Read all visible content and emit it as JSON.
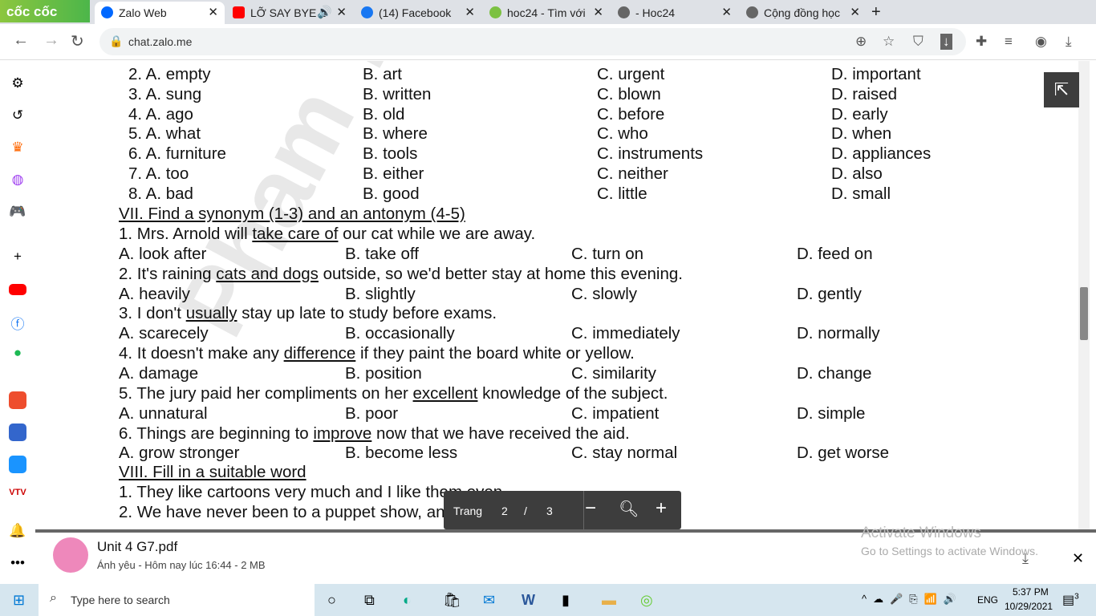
{
  "browser": {
    "brand": "cốc cốc",
    "url": "chat.zalo.me",
    "tabs": [
      {
        "label": "Zalo Web",
        "active": true
      },
      {
        "label": "LỠ SAY BYE L",
        "audio": true
      },
      {
        "label": "(14) Facebook"
      },
      {
        "label": "hoc24 - Tìm với"
      },
      {
        "label": "- Hoc24"
      },
      {
        "label": "Cộng đồng học"
      }
    ]
  },
  "doc": {
    "watermark": "Pham Thu English",
    "mc_rows": [
      [
        "2. A. empty",
        "B. art",
        "C. urgent",
        "D. important"
      ],
      [
        "3. A. sung",
        "B. written",
        "C. blown",
        "D. raised"
      ],
      [
        "4. A. ago",
        "B. old",
        "C. before",
        "D. early"
      ],
      [
        "5. A. what",
        "B. where",
        "C. who",
        "D. when"
      ],
      [
        "6. A. furniture",
        "B. tools",
        "C. instruments",
        "D. appliances"
      ],
      [
        "7. A. too",
        "B. either",
        "C. neither",
        "D. also"
      ],
      [
        "8. A. bad",
        "B. good",
        "C. little",
        "D. small"
      ]
    ],
    "section7": "VII. Find a synonym (1-3) and an antonym (4-5)",
    "questions": [
      {
        "pre": "1. Mrs. Arnold will ",
        "u": "take care of",
        "post": " our cat while we are away.",
        "opts": [
          "A. look after",
          "B. take off",
          "C. turn on",
          "D. feed on"
        ]
      },
      {
        "pre": "2. It's raining ",
        "u": "cats and dogs",
        "post": " outside, so we'd better stay at home this evening.",
        "opts": [
          "A. heavily",
          "B. slightly",
          "C. slowly",
          "D. gently"
        ]
      },
      {
        "pre": "3. I don't ",
        "u": "usually",
        "post": " stay up late to study before exams.",
        "opts": [
          "A. scarecely",
          "B. occasionally",
          "C. immediately",
          "D. normally"
        ]
      },
      {
        "pre": "4. It doesn't make any ",
        "u": "difference",
        "post": " if they paint the board white or yellow.",
        "opts": [
          "A. damage",
          "B. position",
          "C. similarity",
          "D. change"
        ]
      },
      {
        "pre": "5. The jury paid her compliments on her ",
        "u": "excellent",
        "post": " knowledge of the subject.",
        "opts": [
          "A. unnatural",
          "B. poor",
          "C. impatient",
          "D. simple"
        ]
      },
      {
        "pre": "6. Things are beginning to ",
        "u": "improve",
        "post": " now that we have received the aid.",
        "opts": [
          "A. grow stronger",
          "B. become less",
          "C. stay normal",
          "D. get worse"
        ]
      }
    ],
    "section8": "VIII. Fill in a suitable word",
    "fill": [
      "1. They like cartoons very much and I like them even.....",
      "2. We have never been to a puppet show, and.....has Linda."
    ]
  },
  "pager": {
    "label": "Trang",
    "current": "2",
    "sep": "/",
    "total": "3"
  },
  "file": {
    "name": "Unit 4 G7.pdf",
    "meta": "Ánh yêu - Hôm nay lúc 16:44 - 2 MB"
  },
  "activate": {
    "title": "Activate Windows",
    "sub": "Go to Settings to activate Windows."
  },
  "taskbar": {
    "search": "Type here to search",
    "lang": "ENG",
    "time": "5:37 PM",
    "date": "10/29/2021",
    "notif": "3"
  }
}
